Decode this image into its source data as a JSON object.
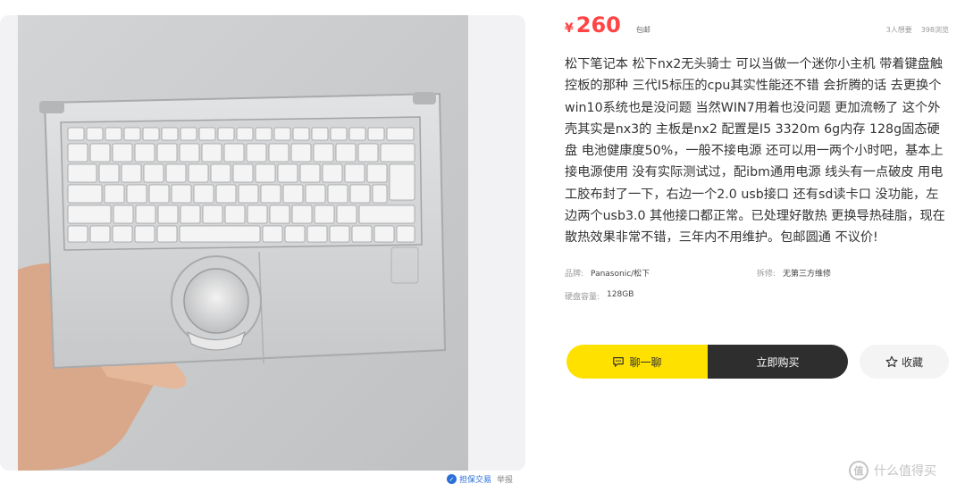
{
  "listing": {
    "currency": "¥",
    "price": "260",
    "shipping": "包邮",
    "wants": "3人想要",
    "views": "398浏览",
    "description": "松下笔记本 松下nx2无头骑士 可以当做一个迷你小主机 带着键盘触控板的那种 三代I5标压的cpu其实性能还不错 会折腾的话 去更换个win10系统也是没问题 当然WIN7用着也没问题 更加流畅了 这个外壳其实是nx3的 主板是nx2 配置是I5 3320m 6g内存 128g固态硬盘 电池健康度50%，一般不接电源 还可以用一两个小时吧，基本上接电源使用 没有实际测试过，配ibm通用电源 线头有一点破皮 用电工胶布封了一下，右边一个2.0 usb接口 还有sd读卡口 没功能，左边两个usb3.0 其他接口都正常。已处理好散热 更换导热硅脂，现在散热效果非常不错，三年内不用维护。包邮圆通 不议价!",
    "attributes": [
      [
        {
          "key": "品牌:",
          "value": "Panasonic/松下"
        },
        {
          "key": "拆修:",
          "value": "无第三方维修"
        }
      ],
      [
        {
          "key": "硬盘容量:",
          "value": "128GB"
        }
      ]
    ]
  },
  "actions": {
    "chat": "聊一聊",
    "buy": "立即购买",
    "favorite": "收藏"
  },
  "media": {
    "protect": "担保交易",
    "report": "举报"
  },
  "watermark": {
    "logo": "值",
    "text": "什么值得买"
  },
  "colors": {
    "price": "#ff4444",
    "chat_button": "#ffe100",
    "buy_button": "#2e2e2e",
    "protect": "#2a6fd8"
  }
}
